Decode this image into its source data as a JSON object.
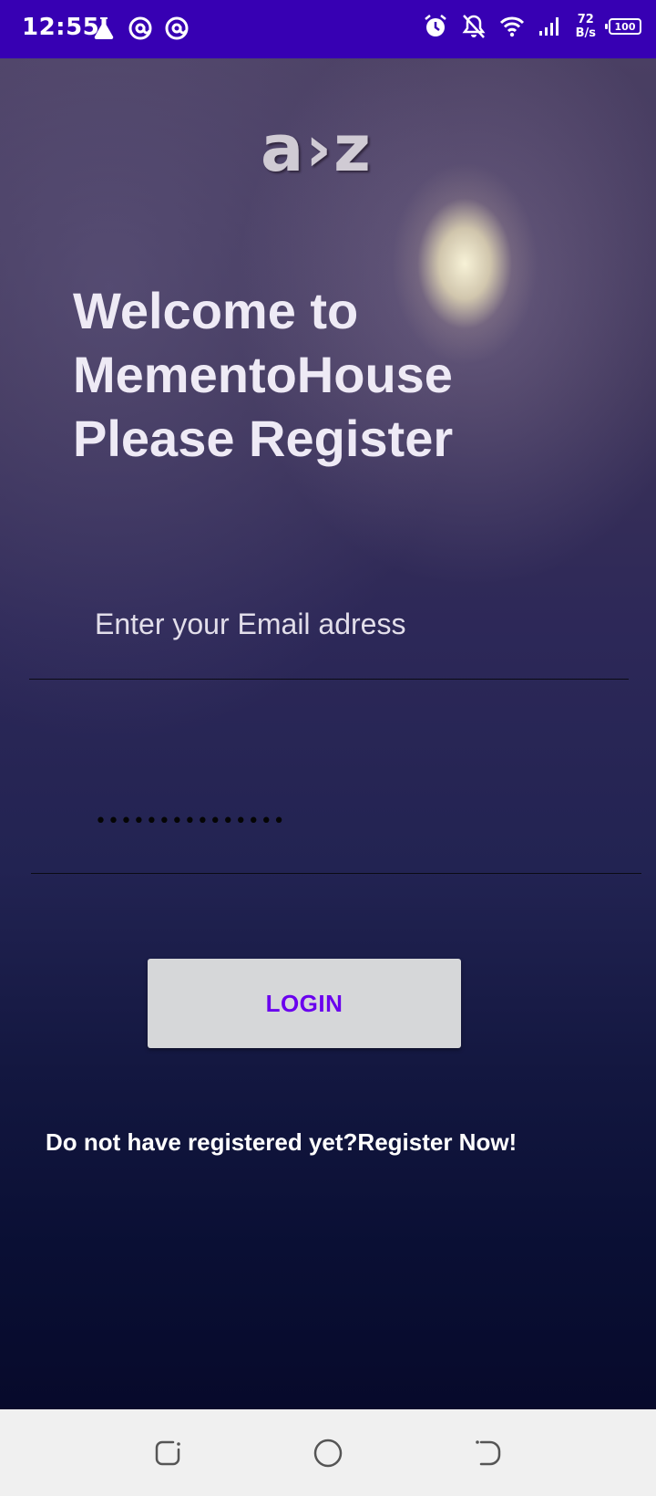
{
  "status_bar": {
    "time": "12:55",
    "left_icons": [
      "flask-icon",
      "at-sign-icon",
      "at-sign-icon"
    ],
    "right_icons": [
      "alarm-icon",
      "bell-off-icon",
      "wifi-icon",
      "signal-icon"
    ],
    "net_speed_value": "72",
    "net_speed_unit": "B/s",
    "battery_level": "100",
    "background_color": "#3700b3"
  },
  "logo": {
    "text": "a›z"
  },
  "welcome": {
    "line1": "Welcome to",
    "line2": "MementoHouse",
    "line3": "Please Register"
  },
  "form": {
    "email_placeholder": "Enter your Email adress",
    "email_value": "",
    "password_masked": "•••••••••••••••",
    "login_label": "LOGIN",
    "register_text": "Do not have registered yet?Register Now!"
  },
  "nav_bar": {
    "buttons": [
      "recent-apps-icon",
      "home-icon",
      "back-icon"
    ]
  },
  "colors": {
    "accent": "#6a00ee",
    "button_background": "#d6d7d9",
    "text_light": "#eeeaf5"
  }
}
